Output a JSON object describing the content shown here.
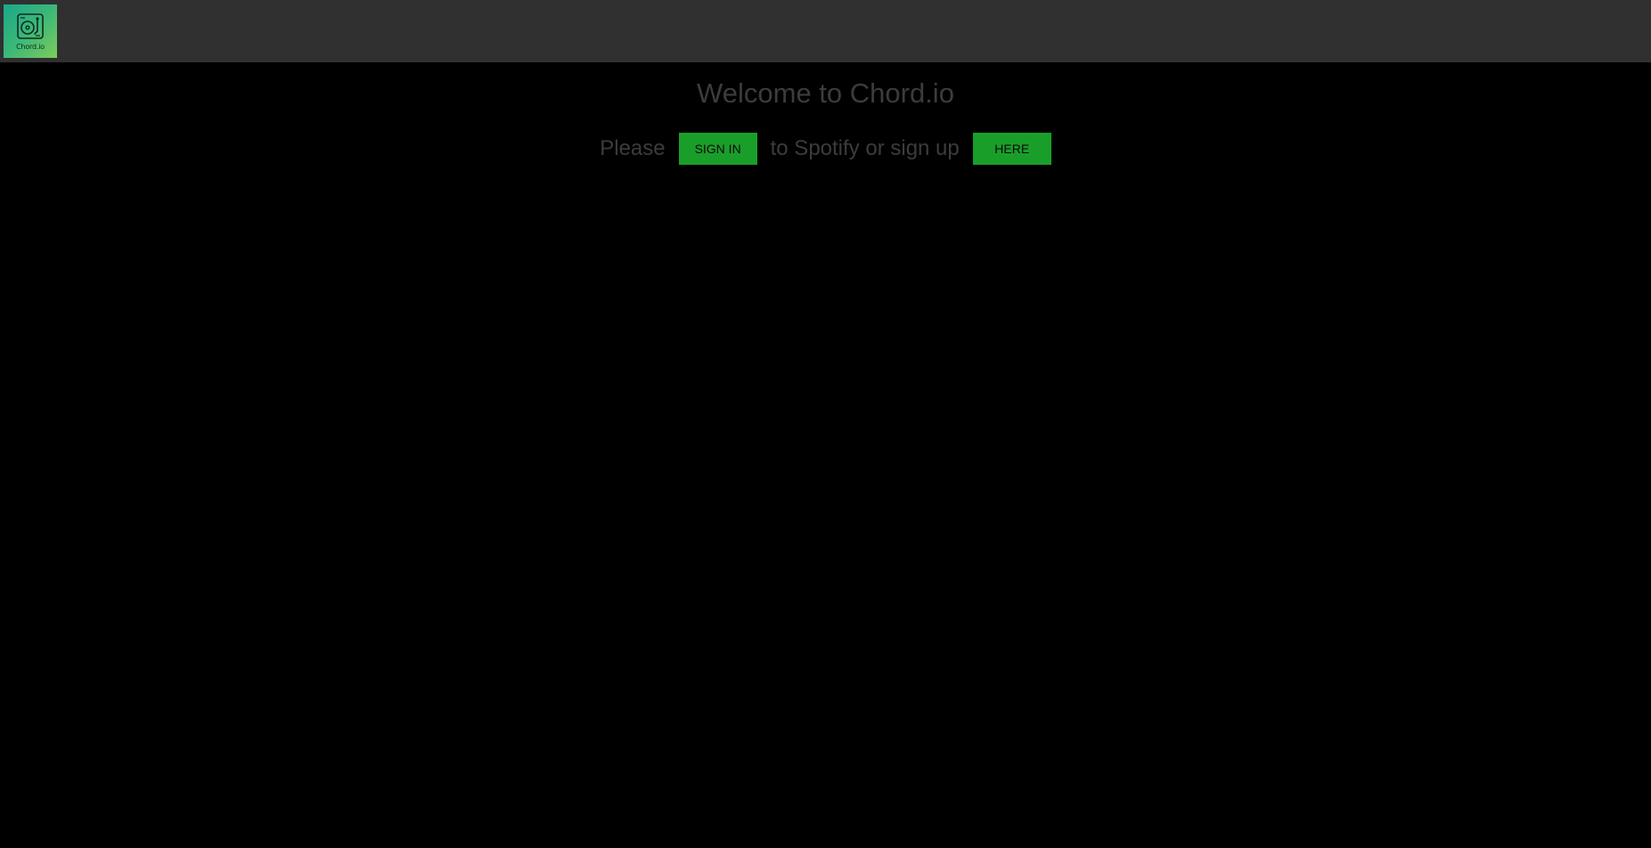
{
  "header": {
    "logo_text": "Chord.io",
    "logo_icon": "turntable-icon",
    "colors": {
      "bar": "#303030",
      "logo_gradient_start": "#1aa88a",
      "logo_gradient_end": "#7ccd5a"
    }
  },
  "main": {
    "title": "Welcome to Chord.io",
    "prompt_before": "Please",
    "signin_label": "SIGN IN",
    "prompt_middle": "to Spotify or sign up",
    "here_label": "HERE",
    "colors": {
      "background": "#000000",
      "text": "#3c3c3c",
      "button": "#1a9e2a"
    }
  }
}
